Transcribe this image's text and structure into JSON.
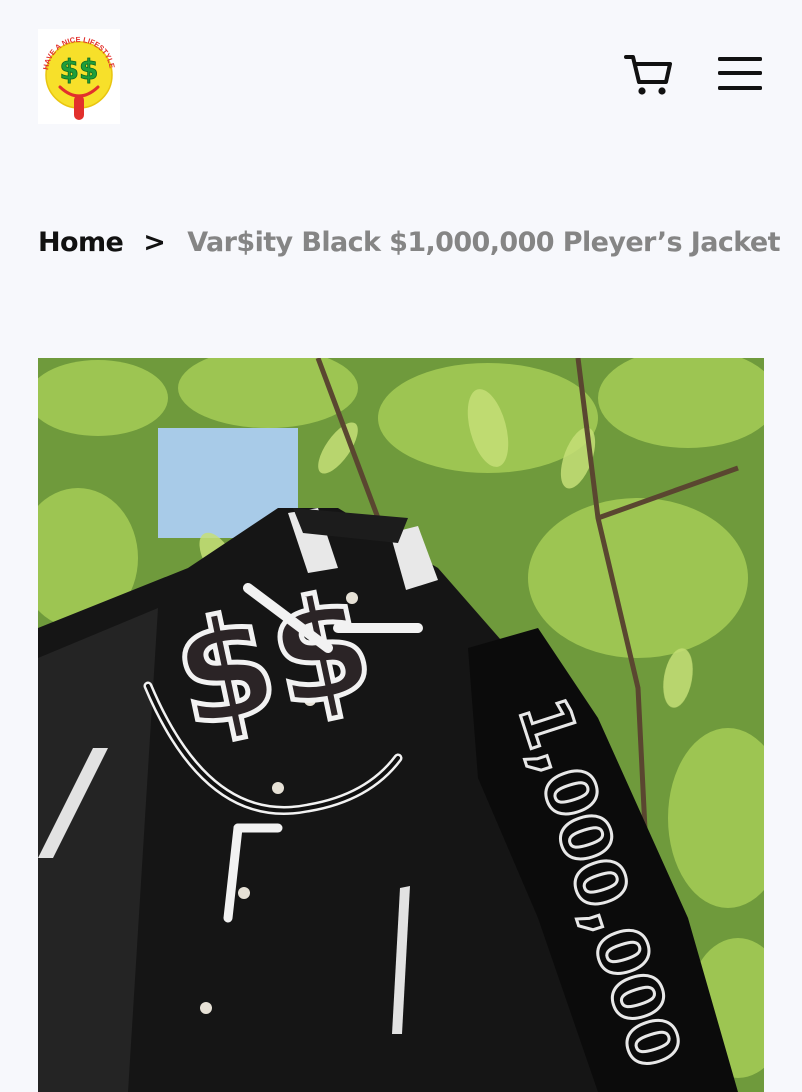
{
  "header": {
    "logo_text": "HAVE A NICE LIFESTYLE",
    "logo_symbol": "$$",
    "cart_icon": "cart-icon",
    "menu_icon": "hamburger-menu-icon"
  },
  "breadcrumb": {
    "home_label": "Home",
    "separator": ">",
    "current_label": "Var$ity Black $1,000,000 Pleyer’s Jacket"
  },
  "product_image": {
    "alt": "Black varsity jacket with dollar-sign smiley patch and 1,000,000 sleeve lettering hanging in a tree",
    "sleeve_text": "1,000,000"
  },
  "colors": {
    "background": "#f7f8fc",
    "text_primary": "#111111",
    "text_muted": "#858585",
    "logo_yellow": "#f7e02a",
    "logo_green": "#1f9e3a",
    "logo_red": "#e2302c"
  }
}
